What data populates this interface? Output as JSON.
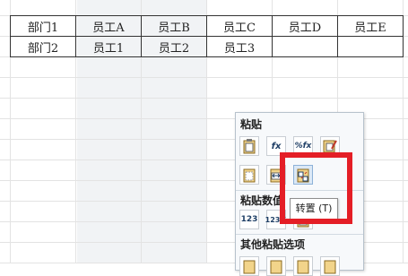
{
  "table": {
    "rows": [
      [
        "部门1",
        "员工A",
        "员工B",
        "员工C",
        "员工D",
        "员工E"
      ],
      [
        "部门2",
        "员工1",
        "员工2",
        "员工3",
        "",
        ""
      ]
    ]
  },
  "paste_menu": {
    "section_paste": "粘贴",
    "section_values": "粘贴数值",
    "section_other": "其他粘贴选项",
    "icons": [
      "paste-icon",
      "paste-formula-icon",
      "paste-formula-number-format-icon",
      "paste-keep-source-format-icon",
      "paste-no-borders-icon",
      "paste-keep-column-width-icon",
      "transpose-icon",
      "paste-values-icon",
      "paste-values-number-format-icon",
      "paste-values-source-format-icon",
      "paste-link-icon",
      "paste-picture-icon",
      "paste-link-picture-icon",
      "paste-format-icon"
    ],
    "fx_label": "fx",
    "percent_fx_label": "%fx",
    "value_label": "123",
    "value_percent_label": "123%"
  },
  "tooltip": {
    "text": "转置 (T)"
  },
  "colors": {
    "highlight": "#e41e26",
    "menu_bg": "#f7f9fb"
  }
}
